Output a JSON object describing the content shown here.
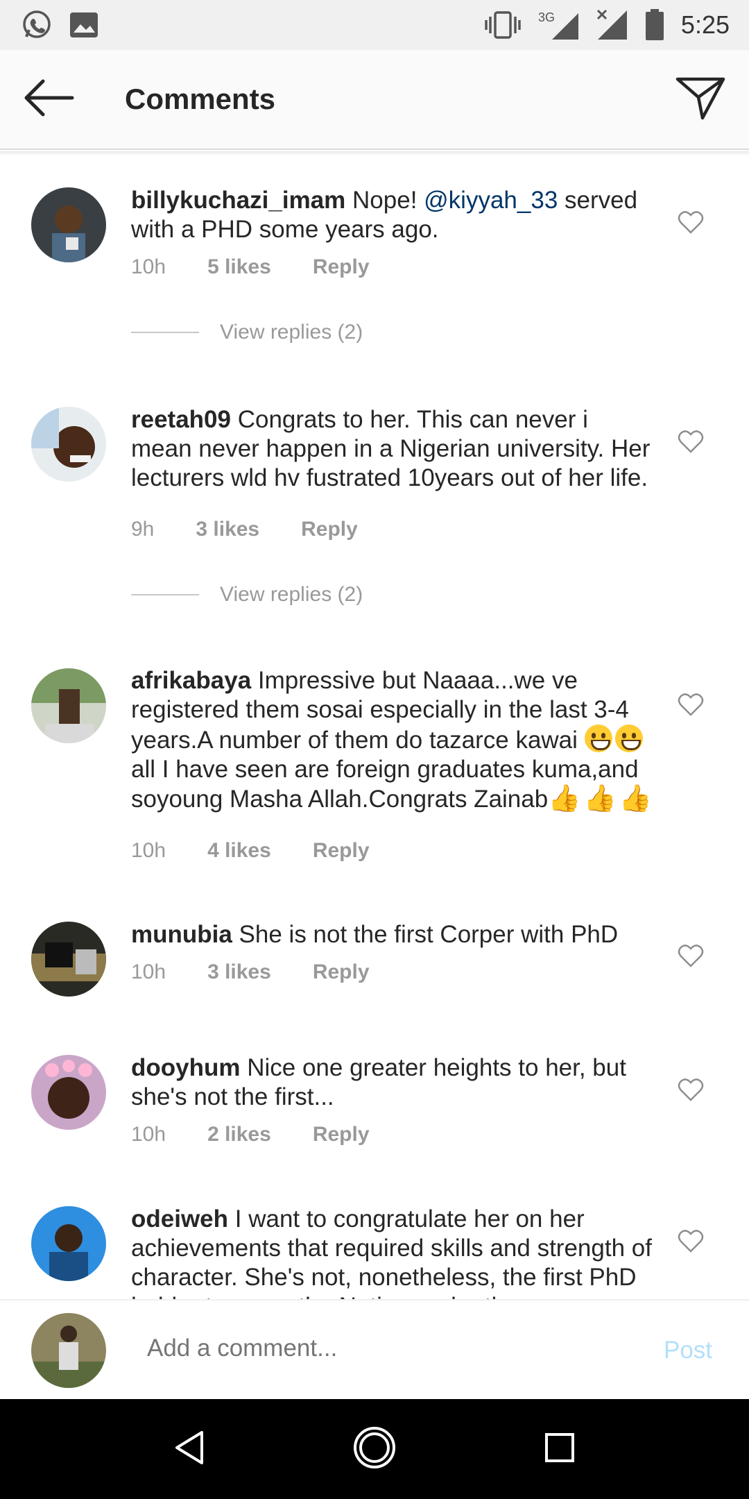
{
  "status_bar": {
    "time": "5:25",
    "network": "3G"
  },
  "header": {
    "title": "Comments"
  },
  "comments": [
    {
      "username": "billykuchazi_imam",
      "text_before": " Nope! ",
      "mention": "@kiyyah_33",
      "text_after": " served with a PHD some years ago.",
      "time": "10h",
      "likes": "5 likes",
      "reply": "Reply",
      "view_replies": "View replies (2)"
    },
    {
      "username": "reetah09",
      "text": " Congrats to her. This can never i mean never happen in a Nigerian university. Her lecturers wld hv fustrated 10years out of her life.",
      "time": "9h",
      "likes": "3 likes",
      "reply": "Reply",
      "view_replies": "View replies (2)"
    },
    {
      "username": "afrikabaya",
      "text_part1": " Impressive but Naaaa...we ve registered them sosai especially in the last 3-4 years.A number of them do tazarce kawai ",
      "text_part2": "all I have seen are foreign graduates kuma,and soyoung Masha Allah.Congrats Zainab",
      "time": "10h",
      "likes": "4 likes",
      "reply": "Reply"
    },
    {
      "username": "munubia",
      "text": " She is not the first Corper with PhD",
      "time": "10h",
      "likes": "3 likes",
      "reply": "Reply"
    },
    {
      "username": "dooyhum",
      "text": " Nice one greater heights to her, but she's not the first...",
      "time": "10h",
      "likes": "2 likes",
      "reply": "Reply"
    },
    {
      "username": "odeiweh",
      "text": " I want to congratulate her on her achievements that required skills and strength of character. She's not, nonetheless, the first PhD holder to serve the Nation under the"
    }
  ],
  "add_comment": {
    "placeholder": "Add a comment...",
    "post_label": "Post"
  },
  "colors": {
    "mention": "#003569",
    "post_disabled": "#b2dffc",
    "meta": "#999999"
  }
}
